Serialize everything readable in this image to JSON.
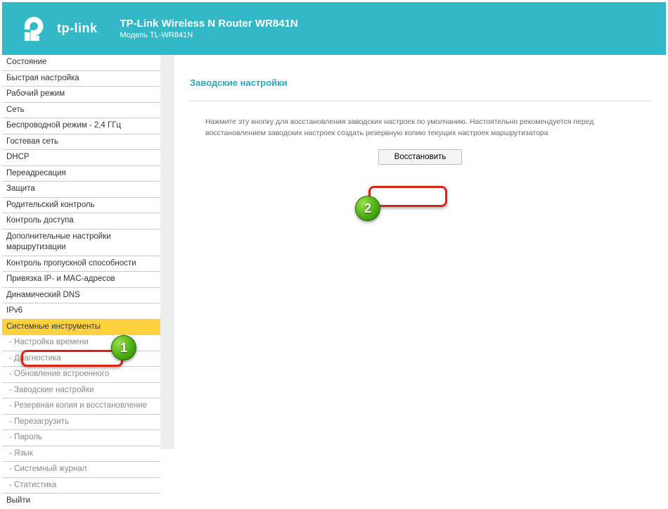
{
  "brand": "tp-link",
  "header": {
    "title": "TP-Link Wireless N Router WR841N",
    "subtitle": "Модель TL-WR841N"
  },
  "sidebar": {
    "items": [
      {
        "label": "Состояние",
        "sub": false
      },
      {
        "label": "Быстрая настройка",
        "sub": false
      },
      {
        "label": "Рабочий режим",
        "sub": false
      },
      {
        "label": "Сеть",
        "sub": false
      },
      {
        "label": "Беспроводной режим - 2,4 ГГц",
        "sub": false
      },
      {
        "label": "Гостевая сеть",
        "sub": false
      },
      {
        "label": "DHCP",
        "sub": false
      },
      {
        "label": "Переадресация",
        "sub": false
      },
      {
        "label": "Защита",
        "sub": false
      },
      {
        "label": "Родительский контроль",
        "sub": false
      },
      {
        "label": "Контроль доступа",
        "sub": false
      },
      {
        "label": "Дополнительные настройки маршрутизации",
        "sub": false
      },
      {
        "label": "Контроль пропускной способности",
        "sub": false
      },
      {
        "label": "Привязка IP- и MAC-адресов",
        "sub": false
      },
      {
        "label": "Динамический DNS",
        "sub": false
      },
      {
        "label": "IPv6",
        "sub": false
      },
      {
        "label": "Системные инструменты",
        "sub": false,
        "active": true
      },
      {
        "label": "- Настройка времени",
        "sub": true
      },
      {
        "label": "- Диагностика",
        "sub": true
      },
      {
        "label": "- Обновление встроенного",
        "sub": true
      },
      {
        "label": "- Заводские настройки",
        "sub": true
      },
      {
        "label": "- Резервная копия и восстановление",
        "sub": true
      },
      {
        "label": "- Перезагрузить",
        "sub": true
      },
      {
        "label": "- Пароль",
        "sub": true
      },
      {
        "label": "- Язык",
        "sub": true
      },
      {
        "label": "- Системный журнал",
        "sub": true
      },
      {
        "label": "- Статистика",
        "sub": true
      },
      {
        "label": "Выйти",
        "sub": false,
        "exit": true
      }
    ]
  },
  "content": {
    "panel_title": "Заводские настройки",
    "description": "Нажмите эту кнопку для восстановления заводских настроек по умолчанию. Настоятельно рекомендуется перед восстановлением заводских настроек создать резервную копию текущих настроек маршрутизатора",
    "reset_button": "Восстановить"
  },
  "callouts": {
    "one": "1",
    "two": "2"
  }
}
